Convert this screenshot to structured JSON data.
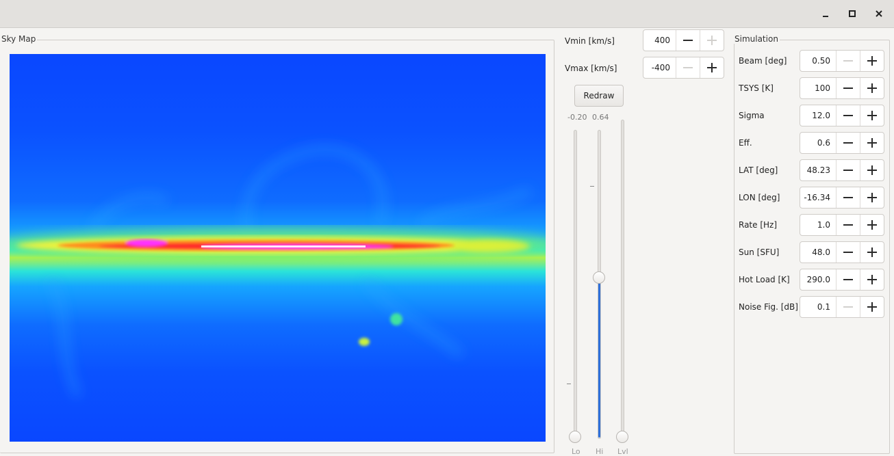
{
  "window": {
    "controls": {
      "minimize": "minimize-icon",
      "maximize": "maximize-icon",
      "close": "close-icon"
    }
  },
  "skymap": {
    "title": "Sky Map"
  },
  "velocity": {
    "vmin": {
      "label": "Vmin [km/s]",
      "value": "400",
      "minus_enabled": true,
      "plus_enabled": false
    },
    "vmax": {
      "label": "Vmax [km/s]",
      "value": "-400",
      "minus_enabled": false,
      "plus_enabled": true
    },
    "redraw_label": "Redraw"
  },
  "sliders": {
    "lo": {
      "label": "Lo",
      "value_label": "-0.20",
      "level": 0.0
    },
    "hi": {
      "label": "Hi",
      "value_label": "0.64",
      "level": 0.52
    },
    "lvl": {
      "label": "Lvl",
      "level": 0.0
    }
  },
  "simulation": {
    "title": "Simulation",
    "rows": [
      {
        "label": "Beam [deg]",
        "value": "0.50",
        "minus_enabled": false,
        "plus_enabled": true
      },
      {
        "label": "TSYS [K]",
        "value": "100",
        "minus_enabled": true,
        "plus_enabled": true
      },
      {
        "label": "Sigma",
        "value": "12.0",
        "minus_enabled": true,
        "plus_enabled": true
      },
      {
        "label": "Eff.",
        "value": "0.6",
        "minus_enabled": true,
        "plus_enabled": true
      },
      {
        "label": "LAT [deg]",
        "value": "48.23",
        "minus_enabled": true,
        "plus_enabled": true
      },
      {
        "label": "LON [deg]",
        "value": "-16.34",
        "minus_enabled": true,
        "plus_enabled": true
      },
      {
        "label": "Rate [Hz]",
        "value": "1.0",
        "minus_enabled": true,
        "plus_enabled": true
      },
      {
        "label": "Sun [SFU]",
        "value": "48.0",
        "minus_enabled": true,
        "plus_enabled": true
      },
      {
        "label": "Hot Load [K]",
        "value": "290.0",
        "minus_enabled": true,
        "plus_enabled": true
      },
      {
        "label": "Noise Fig. [dB]",
        "value": "0.1",
        "minus_enabled": false,
        "plus_enabled": true
      }
    ]
  },
  "colors": {
    "accent": "#2e6fd9",
    "map_low": "#0a47ff",
    "map_mid": "#2be4d8",
    "map_high": "#ff2a2a",
    "map_peak": "#ff33ff"
  }
}
